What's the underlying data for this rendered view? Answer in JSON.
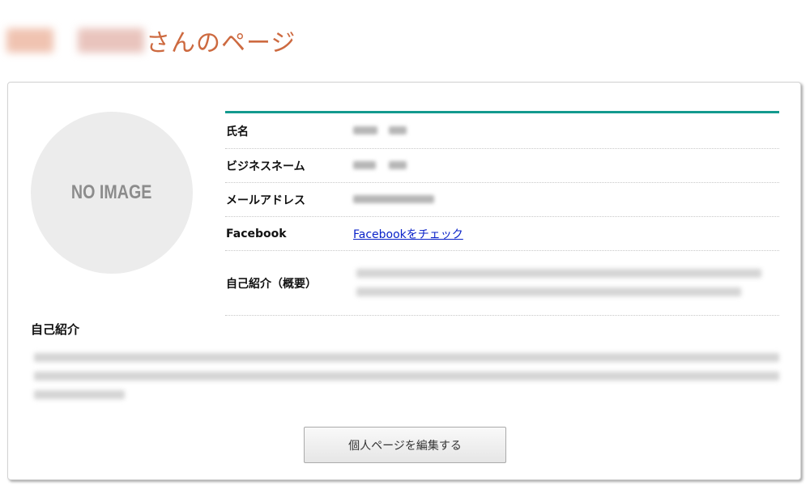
{
  "header": {
    "title_suffix": "さんのページ",
    "accent_color": "#cd6a40"
  },
  "profile": {
    "avatar_placeholder": "NO IMAGE",
    "fields": {
      "name_label": "氏名",
      "business_name_label": "ビジネスネーム",
      "email_label": "メールアドレス",
      "facebook_label": "Facebook",
      "facebook_link": "Facebookをチェック",
      "summary_label": "自己紹介（概要）"
    },
    "divider_color": "#139a8e"
  },
  "introduction": {
    "title": "自己紹介"
  },
  "actions": {
    "edit_button": "個人ページを編集する"
  }
}
